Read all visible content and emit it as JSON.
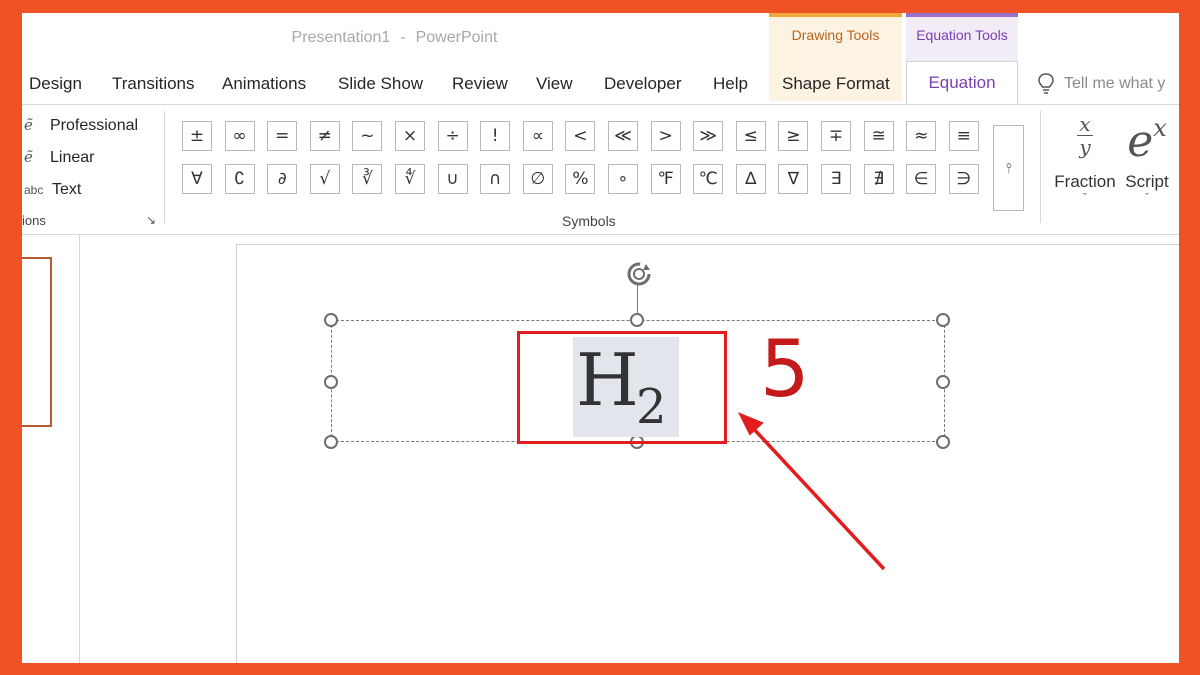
{
  "window": {
    "document_name": "Presentation1",
    "separator": "-",
    "app_name": "PowerPoint"
  },
  "context_groups": {
    "drawing_tools": "Drawing Tools",
    "equation_tools": "Equation Tools"
  },
  "tabs": [
    "Design",
    "Transitions",
    "Animations",
    "Slide Show",
    "Review",
    "View",
    "Developer",
    "Help",
    "Shape Format",
    "Equation"
  ],
  "active_tab": "Equation",
  "tell_me": "Tell me what y",
  "conversions": {
    "professional": "Professional",
    "linear": "Linear",
    "text_icon": "abc",
    "text": "Text",
    "group_label": "ions",
    "launcher": "↘"
  },
  "symbols": {
    "row1": [
      "±",
      "∞",
      "=",
      "≠",
      "~",
      "×",
      "÷",
      "!",
      "∝",
      "<",
      "≪",
      ">",
      "≫",
      "≤",
      "≥",
      "∓",
      "≅",
      "≈",
      "≡"
    ],
    "row2": [
      "∀",
      "∁",
      "∂",
      "√",
      "∛",
      "∜",
      "∪",
      "∩",
      "∅",
      "%",
      "∘",
      "℉",
      "℃",
      "∆",
      "∇",
      "∃",
      "∄",
      "∈",
      "∋"
    ],
    "more": "⫯",
    "group_label": "Symbols"
  },
  "structures": {
    "fraction_label": "Fraction",
    "fraction_num": "x",
    "fraction_den": "y",
    "script_label": "Script",
    "script_base": "e",
    "script_exp": "x",
    "chevron": "ˇ"
  },
  "equation": {
    "base": "H",
    "subscript": "2"
  },
  "annotation": {
    "step_number": "5",
    "callout_color": "#e21d1d"
  },
  "colors": {
    "background_border": "#ee5225",
    "drawing_tools_accent": "#f2a73b",
    "equation_tools_accent": "#9b6fc9"
  }
}
